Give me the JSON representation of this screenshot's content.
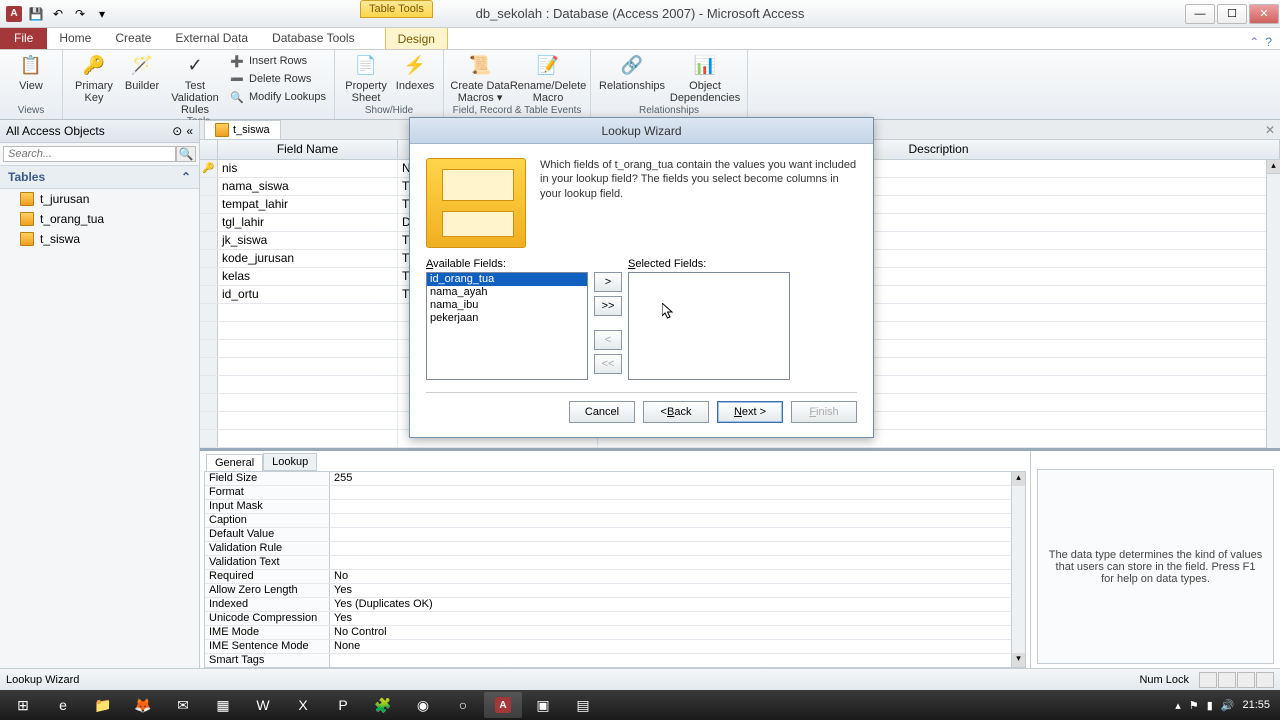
{
  "window": {
    "title": "db_sekolah : Database (Access 2007) - Microsoft Access",
    "table_tools": "Table Tools"
  },
  "tabs": {
    "file": "File",
    "home": "Home",
    "create": "Create",
    "external": "External Data",
    "dbtools": "Database Tools",
    "design": "Design"
  },
  "ribbon": {
    "view": "View",
    "views_label": "Views",
    "primary_key": "Primary Key",
    "builder": "Builder",
    "test_rules": "Test Validation Rules",
    "insert_rows": "Insert Rows",
    "delete_rows": "Delete Rows",
    "modify_lookups": "Modify Lookups",
    "tools_label": "Tools",
    "property_sheet": "Property Sheet",
    "indexes": "Indexes",
    "showhide_label": "Show/Hide",
    "create_macros": "Create Data Macros ▾",
    "rename_macro": "Rename/Delete Macro",
    "events_label": "Field, Record & Table Events",
    "relationships": "Relationships",
    "object_deps": "Object Dependencies",
    "rel_label": "Relationships"
  },
  "nav": {
    "header": "All Access Objects",
    "search_ph": "Search...",
    "tables": "Tables",
    "items": [
      "t_jurusan",
      "t_orang_tua",
      "t_siswa"
    ]
  },
  "doc": {
    "tab": "t_siswa",
    "col_fieldname": "Field Name",
    "col_datatype": "Data Type",
    "col_desc": "Description",
    "rows": [
      {
        "name": "nis",
        "type": "N",
        "key": true
      },
      {
        "name": "nama_siswa",
        "type": "T"
      },
      {
        "name": "tempat_lahir",
        "type": "T"
      },
      {
        "name": "tgl_lahir",
        "type": "D"
      },
      {
        "name": "jk_siswa",
        "type": "T"
      },
      {
        "name": "kode_jurusan",
        "type": "T"
      },
      {
        "name": "kelas",
        "type": "T"
      },
      {
        "name": "id_ortu",
        "type": "T"
      }
    ]
  },
  "propsheet": {
    "tab_general": "General",
    "tab_lookup": "Lookup",
    "rows": [
      {
        "l": "Field Size",
        "v": "255"
      },
      {
        "l": "Format",
        "v": ""
      },
      {
        "l": "Input Mask",
        "v": ""
      },
      {
        "l": "Caption",
        "v": ""
      },
      {
        "l": "Default Value",
        "v": ""
      },
      {
        "l": "Validation Rule",
        "v": ""
      },
      {
        "l": "Validation Text",
        "v": ""
      },
      {
        "l": "Required",
        "v": "No"
      },
      {
        "l": "Allow Zero Length",
        "v": "Yes"
      },
      {
        "l": "Indexed",
        "v": "Yes (Duplicates OK)"
      },
      {
        "l": "Unicode Compression",
        "v": "Yes"
      },
      {
        "l": "IME Mode",
        "v": "No Control"
      },
      {
        "l": "IME Sentence Mode",
        "v": "None"
      },
      {
        "l": "Smart Tags",
        "v": ""
      }
    ],
    "hint": "The data type determines the kind of values that users can store in the field. Press F1 for help on data types."
  },
  "dialog": {
    "title": "Lookup Wizard",
    "question": "Which fields of t_orang_tua contain the values you want included in your lookup field? The fields you select become columns in your lookup field.",
    "avail_label": "Available Fields:",
    "sel_label": "Selected Fields:",
    "available": [
      "id_orang_tua",
      "nama_ayah",
      "nama_ibu",
      "pekerjaan"
    ],
    "selected": [],
    "btn_add": ">",
    "btn_addall": ">>",
    "btn_rem": "<",
    "btn_remall": "<<",
    "cancel": "Cancel",
    "back": "< Back",
    "next": "Next >",
    "finish": "Finish"
  },
  "status": {
    "left": "Lookup Wizard",
    "numlock": "Num Lock"
  },
  "taskbar": {
    "time": "21:55"
  }
}
